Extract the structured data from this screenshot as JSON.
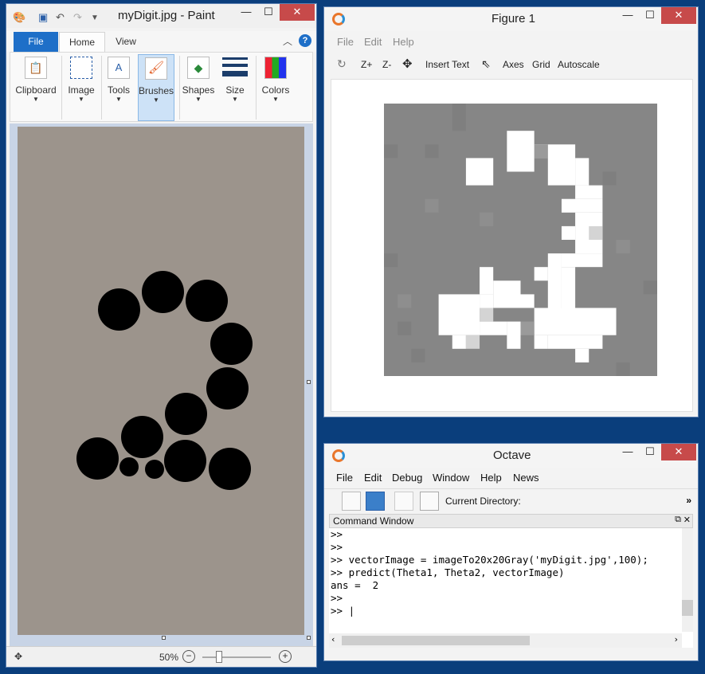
{
  "paint": {
    "title": "myDigit.jpg - Paint",
    "tabs": {
      "file": "File",
      "home": "Home",
      "view": "View"
    },
    "help_glyph": "?",
    "ribbon": [
      {
        "id": "clipboard",
        "label": "Clipboard"
      },
      {
        "id": "image",
        "label": "Image"
      },
      {
        "id": "tools",
        "label": "Tools"
      },
      {
        "id": "brushes",
        "label": "Brushes",
        "selected": true
      },
      {
        "id": "shapes",
        "label": "Shapes"
      },
      {
        "id": "size",
        "label": "Size"
      },
      {
        "id": "colors",
        "label": "Colors"
      }
    ],
    "status": {
      "zoom": "50%"
    }
  },
  "figure": {
    "title": "Figure 1",
    "menu": {
      "file": "File",
      "edit": "Edit",
      "help": "Help"
    },
    "toolbar": {
      "zoom_in": "Z+",
      "zoom_out": "Z-",
      "insert_text": "Insert Text",
      "axes": "Axes",
      "grid": "Grid",
      "autoscale": "Autoscale"
    }
  },
  "octave": {
    "title": "Octave",
    "menu": {
      "file": "File",
      "edit": "Edit",
      "debug": "Debug",
      "window": "Window",
      "help": "Help",
      "news": "News"
    },
    "current_directory_label": "Current Directory:",
    "command_window_label": "Command Window",
    "console_lines": [
      ">>",
      ">>",
      ">> vectorImage = imageTo20x20Gray('myDigit.jpg',100);",
      ">> predict(Theta1, Theta2, vectorImage)",
      "ans =  2",
      ">>",
      ">> |"
    ]
  },
  "colors": {
    "desktop": "#0a3e7c",
    "paint_file_tab": "#1e6fc8",
    "close_button": "#c74a4a",
    "photo_bg": "#9c948c",
    "pixel_gray": "#868686",
    "pixel_white": "#ffffff"
  },
  "icons": [
    "paint-app-icon",
    "save-icon",
    "undo-icon",
    "redo-icon",
    "octave-icon",
    "pan-icon",
    "zoom-minus-icon",
    "zoom-plus-icon",
    "new-file-icon",
    "open-folder-icon",
    "copy-icon",
    "paste-icon"
  ]
}
